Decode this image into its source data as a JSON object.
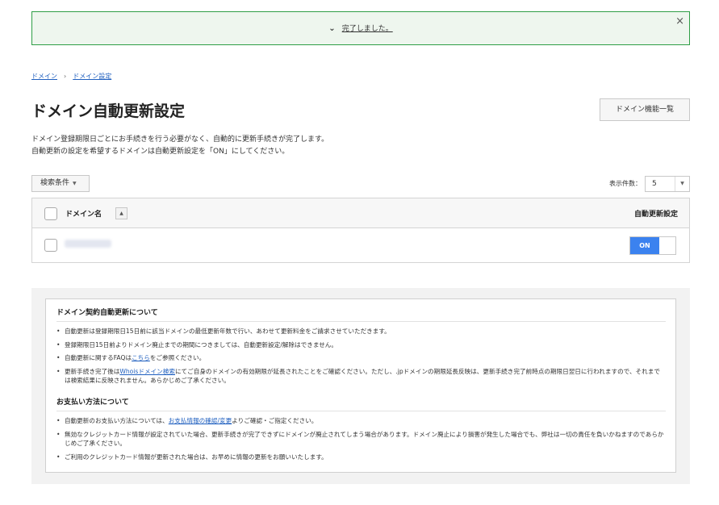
{
  "notice": {
    "message": "完了しました。",
    "close_symbol": "×"
  },
  "breadcrumb": {
    "items": [
      "ドメイン",
      "ドメイン設定"
    ],
    "separator": "›"
  },
  "page": {
    "title": "ドメイン自動更新設定",
    "features_button": "ドメイン機能一覧",
    "description_line1": "ドメイン登録期限日ごとにお手続きを行う必要がなく、自動的に更新手続きが完了します。",
    "description_line2": "自動更新の設定を希望するドメインは自動更新設定を「ON」にしてください。"
  },
  "controls": {
    "search_label": "検索条件",
    "perpage_label": "表示件数：",
    "perpage_value": "5"
  },
  "table": {
    "col_domain": "ドメイン名",
    "col_auto": "自動更新設定",
    "rows": [
      {
        "toggle": "ON"
      }
    ]
  },
  "info": {
    "section1_title": "ドメイン契約自動更新について",
    "s1_item1": "自動更新は登録期限日15日前に該当ドメインの最低更新年数で行い、あわせて更新料金をご請求させていただきます。",
    "s1_item2": "登録期限日15日前よりドメイン廃止までの期間につきましては、自動更新設定/解除はできません。",
    "s1_item3_pre": "自動更新に関するFAQは",
    "s1_item3_link": "こちら",
    "s1_item3_post": "をご参照ください。",
    "s1_item4_pre": "更新手続き完了後は",
    "s1_item4_link": "Whoisドメイン検索",
    "s1_item4_post": "にてご自身のドメインの有効期限が延長されたことをご確認ください。ただし、.jpドメインの期限延長反映は、更新手続き完了前時点の期限日翌日に行われますので、それまでは検索結果に反映されません。あらかじめご了承ください。",
    "section2_title": "お支払い方法について",
    "s2_item1_pre": "自動更新のお支払い方法については、",
    "s2_item1_link": "お支払情報の確認/変更",
    "s2_item1_post": "よりご確認・ご指定ください。",
    "s2_item2": "無効なクレジットカード情報が設定されていた場合、更新手続きが完了できずにドメインが廃止されてしまう場合があります。ドメイン廃止により損害が発生した場合でも、弊社は一切の責任を負いかねますのであらかじめご了承ください。",
    "s2_item3": "ご利用のクレジットカード情報が更新された場合は、お早めに情報の更新をお願いいたします。"
  },
  "colors": {
    "notice_border": "#2e9e45",
    "notice_bg": "#eef6ee",
    "link": "#1f5fbf",
    "toggle_on": "#3b82ef"
  }
}
